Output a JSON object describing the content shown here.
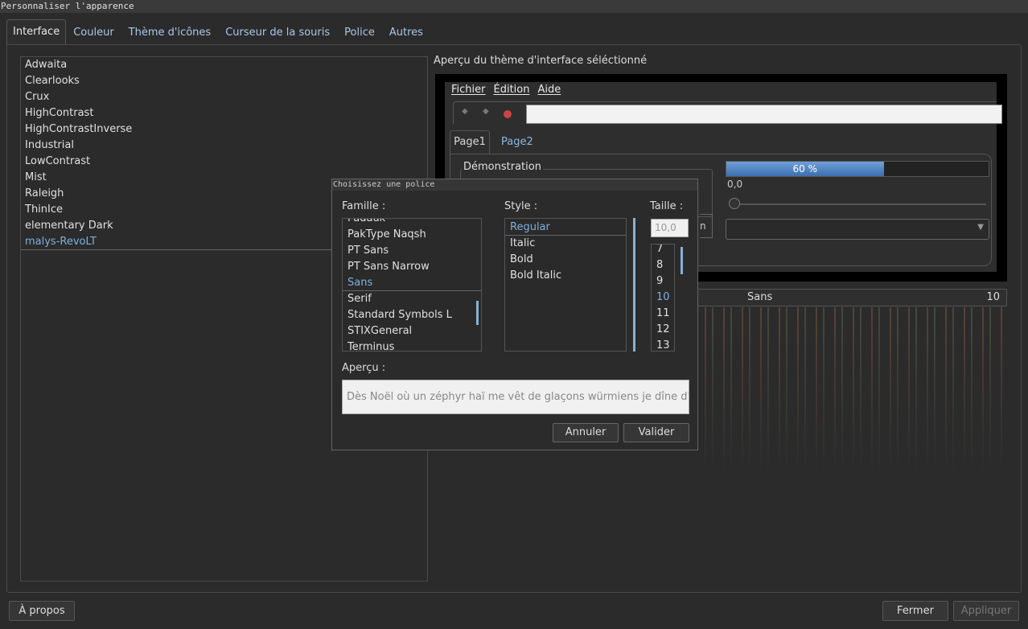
{
  "window": {
    "title": "Personnaliser l'apparence"
  },
  "tabs": [
    {
      "label": "Interface",
      "active": true
    },
    {
      "label": "Couleur"
    },
    {
      "label": "Thème d'icônes"
    },
    {
      "label": "Curseur de la souris"
    },
    {
      "label": "Police"
    },
    {
      "label": "Autres"
    }
  ],
  "themes": {
    "items": [
      "Adwaita",
      "Clearlooks",
      "Crux",
      "HighContrast",
      "HighContrastInverse",
      "Industrial",
      "LowContrast",
      "Mist",
      "Raleigh",
      "ThinIce",
      "elementary Dark",
      "malys-RevoLT"
    ],
    "selected": "malys-RevoLT"
  },
  "preview": {
    "label": "Aperçu du thème d'interface séléctionné",
    "menu": [
      "Fichier",
      "Édition",
      "Aide"
    ],
    "tabs": [
      "Page1",
      "Page2"
    ],
    "group_title": "Démonstration",
    "progress": {
      "percent": 60,
      "label": "60 %"
    },
    "value_label": "0,0",
    "cut_button": "n"
  },
  "font_button": {
    "family": "Sans",
    "size": "10"
  },
  "font_dialog": {
    "title": "Choisissez une police",
    "family_label": "Famille :",
    "style_label": "Style :",
    "size_label": "Taille :",
    "families": [
      "Padauk",
      "PakType Naqsh",
      "PT Sans",
      "PT Sans Narrow",
      "Sans",
      "Serif",
      "Standard Symbols L",
      "STIXGeneral",
      "Terminus"
    ],
    "selected_family": "Sans",
    "styles": [
      "Regular",
      "Italic",
      "Bold",
      "Bold Italic"
    ],
    "selected_style": "Regular",
    "size_value": "10,0",
    "sizes": [
      "7",
      "8",
      "9",
      "10",
      "11",
      "12",
      "13"
    ],
    "selected_size": "10",
    "preview_label": "Aperçu :",
    "preview_text": "Dès Noël où un zéphyr haï me vêt de glaçons würmiens je dîne d'exquis rôtis de bœuf",
    "cancel": "Annuler",
    "ok": "Valider"
  },
  "bottom": {
    "about": "À propos",
    "close": "Fermer",
    "apply": "Appliquer"
  }
}
